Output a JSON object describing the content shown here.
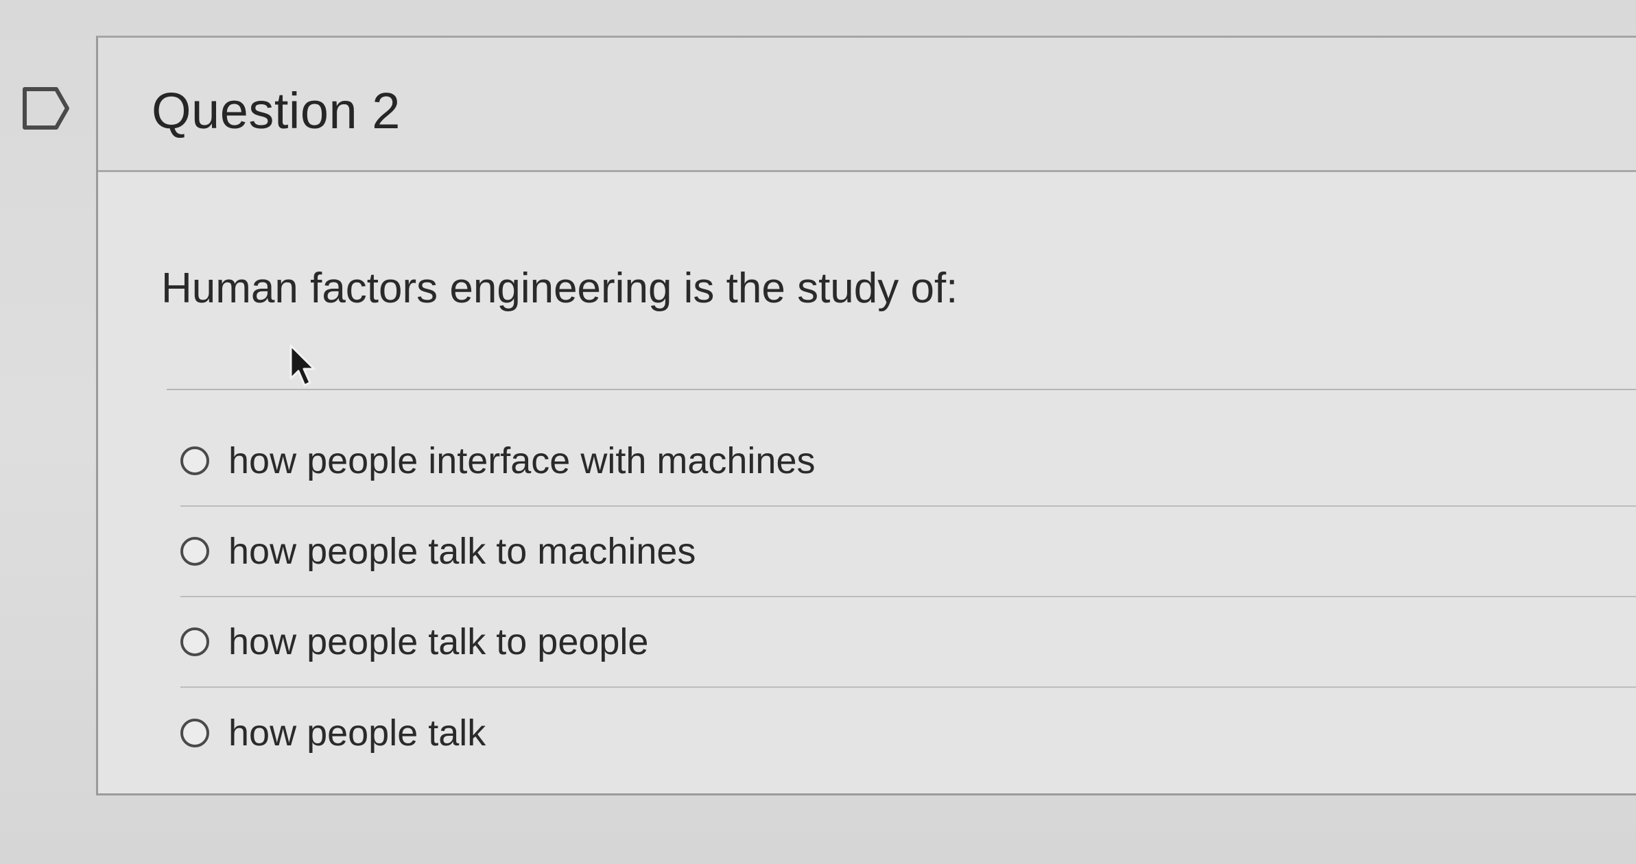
{
  "question": {
    "title": "Question 2",
    "text": "Human factors engineering is the study of:"
  },
  "answers": [
    {
      "label": "how people interface with machines",
      "selected": false
    },
    {
      "label": "how people talk to machines",
      "selected": false
    },
    {
      "label": "how people talk to people",
      "selected": false
    },
    {
      "label": "how people talk",
      "selected": false
    }
  ],
  "icons": {
    "flag": "flag-icon",
    "cursor": "mouse-pointer-icon",
    "radio": "radio-unchecked-icon"
  },
  "colors": {
    "text": "#2a2a2a",
    "border": "#9a9a9a",
    "radio": "#4a4a4a"
  }
}
